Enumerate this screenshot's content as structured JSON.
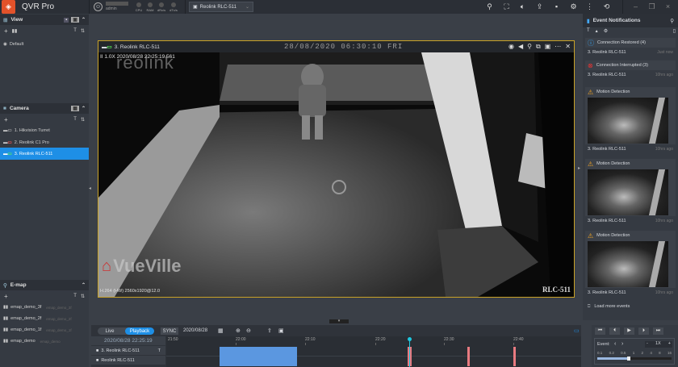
{
  "app": {
    "title": "QVR Pro",
    "logo_icon": "qvr-shield-logo"
  },
  "user": {
    "name": "admin"
  },
  "gauges": [
    "CPU",
    "RAM",
    "dRx/s",
    "dTx/s"
  ],
  "camera_select": {
    "value": "Reolink RLC-511"
  },
  "toolbar_icons": [
    "search-icon",
    "fullscreen-icon",
    "speaker-icon",
    "export-icon",
    "lock-icon",
    "gear-icon",
    "more-icon",
    "logout-icon"
  ],
  "window_controls": [
    "minimize",
    "restore",
    "close"
  ],
  "sidebar": {
    "view": {
      "title": "View",
      "items": [
        "Default"
      ]
    },
    "camera": {
      "title": "Camera",
      "items": [
        "1. Hikvision Turret",
        "2. Reolink C1 Pro",
        "3. Reolink RLC-511"
      ],
      "selected": 2
    },
    "emap": {
      "title": "E-map",
      "items": [
        {
          "name": "emap_demo_3f",
          "sub": "emap_demo_3f"
        },
        {
          "name": "emap_demo_2f",
          "sub": "emap_demo_2f"
        },
        {
          "name": "emap_demo_1f",
          "sub": "emap_demo_1f"
        },
        {
          "name": "emap_demo",
          "sub": "emap_demo"
        }
      ]
    }
  },
  "video": {
    "title": "3. Reolink RLC-511",
    "osd_date": "28/08/2020 06:30:10 FRI",
    "playback_info": "II 1.0X  2020/08/28 22:25:19.561",
    "brand_watermark": "reolink",
    "site_watermark": "VueVille",
    "codec": "H.264 (HW) 2560x1920@12.0",
    "camera_label": "RLC-511",
    "border_color": "#c9a227"
  },
  "events": {
    "title": "Event Notifications",
    "items": [
      {
        "type": "info",
        "title": "Connection Restored (4)",
        "camera": "3. Reolink RLC-511",
        "ago": "Just now"
      },
      {
        "type": "error",
        "title": "Connection Interrupted (3)",
        "camera": "3. Reolink RLC-511",
        "ago": "10hrs ago"
      },
      {
        "type": "warning",
        "title": "Motion Detection",
        "camera": "3. Reolink RLC-511",
        "ago": "10hrs ago"
      },
      {
        "type": "warning",
        "title": "Motion Detection",
        "camera": "3. Reolink RLC-511",
        "ago": "10hrs ago"
      },
      {
        "type": "warning",
        "title": "Motion Detection",
        "camera": "3. Reolink RLC-511",
        "ago": "10hrs ago"
      }
    ],
    "load_more": "Load more events"
  },
  "timeline": {
    "live": "Live",
    "playback": "Playback",
    "sync": "SYNC",
    "date": "2020/08/28",
    "current_time": "2020/08/28 22:25:19",
    "ticks": [
      "21:50",
      "22:00",
      "22:10",
      "22:20",
      "22:30",
      "22:40"
    ],
    "rows": [
      "3. Reolink RLC-511",
      "Reolink RLC-511"
    ],
    "accent": "#1e8fe6"
  },
  "playback_controls": {
    "event_label": "Event:",
    "speed": "1X",
    "speeds": [
      "0.1",
      "0.2",
      "0.5",
      "1",
      "2",
      "4",
      "8",
      "16"
    ],
    "speed_level": "1"
  }
}
